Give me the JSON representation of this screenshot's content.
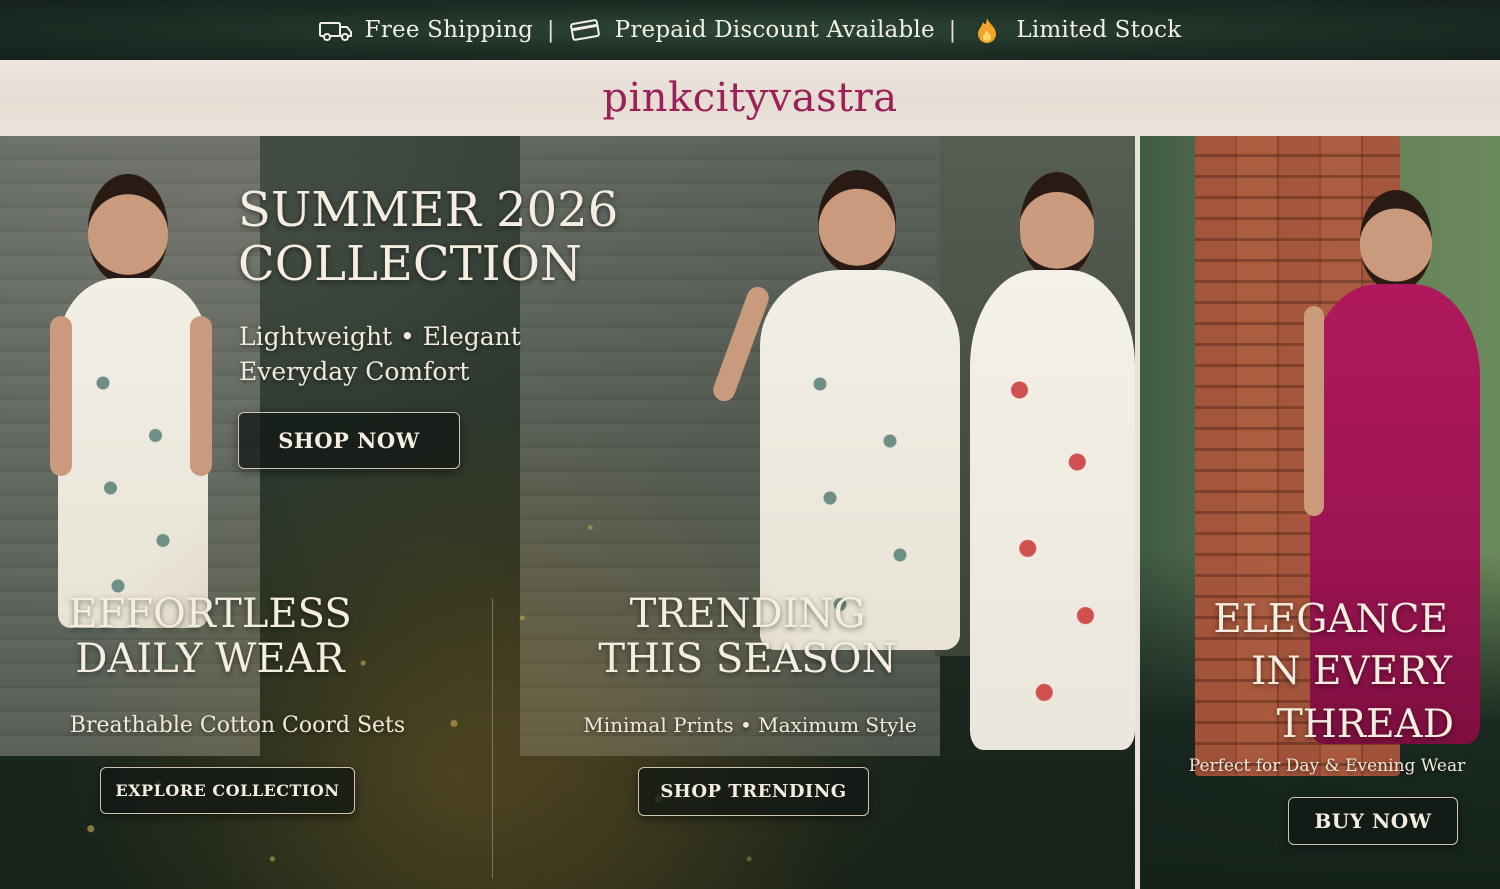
{
  "promo_bar": {
    "items": [
      {
        "icon": "truck-icon",
        "label": "Free Shipping"
      },
      {
        "icon": "card-icon",
        "label": "Prepaid Discount Available"
      },
      {
        "icon": "fire-icon",
        "label": "Limited Stock"
      }
    ],
    "separator": "|"
  },
  "brand": {
    "logo_text": "pinkcityvastra",
    "color": "#9a2157"
  },
  "hero": {
    "main": {
      "title_line1": "SUMMER 2026",
      "title_line2": "COLLECTION",
      "subtitle_line1": "Lightweight • Elegant",
      "subtitle_line2": "Everyday Comfort",
      "button": "SHOP NOW"
    },
    "left_block": {
      "title_line1": "EFFORTLESS",
      "title_line2": "DAILY WEAR",
      "subtitle": "Breathable Cotton Coord Sets",
      "button": "EXPLORE COLLECTION"
    },
    "center_block": {
      "title_line1": "TRENDING",
      "title_line2": "THIS SEASON",
      "subtitle": "Minimal Prints • Maximum Style",
      "button": "SHOP TRENDING"
    }
  },
  "right_panel": {
    "title_line1": "ELEGANCE",
    "title_line2": "IN EVERY",
    "title_line3": "THREAD",
    "subtitle": "Perfect for Day & Evening Wear",
    "button": "BUY NOW"
  },
  "colors": {
    "dark_green": "#1d2e25",
    "cream_text": "#f5eee0",
    "brand_pink": "#9a2157",
    "dress_magenta": "#b0185e"
  }
}
